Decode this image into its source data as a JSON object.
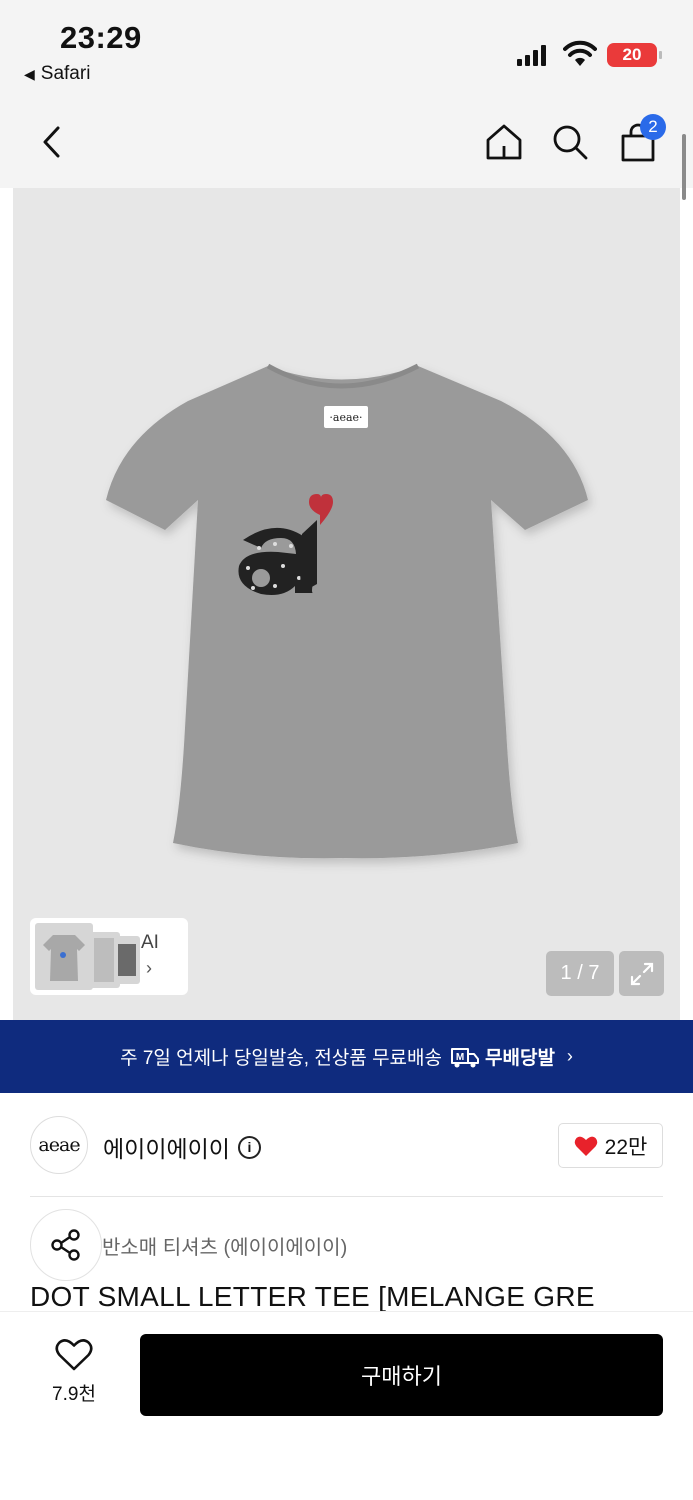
{
  "status_bar": {
    "time": "23:29",
    "back_app": "Safari",
    "battery": "20"
  },
  "nav": {
    "cart_count": "2"
  },
  "gallery": {
    "ai_label": "AI",
    "counter": "1 / 7",
    "logo_tag": "·aeae·"
  },
  "banner": {
    "text": "주 7일 언제나 당일발송, 전상품 무료배송",
    "brand": "무배당발"
  },
  "brand": {
    "logo": "aeae",
    "name": "에이이에이이",
    "likes": "22만"
  },
  "product": {
    "category": "반소매 티셔츠 (에이이에이이)",
    "title": "DOT SMALL LETTER TEE [MELANGE GRE"
  },
  "bottom": {
    "wish_count": "7.9천",
    "buy_label": "구매하기"
  },
  "colors": {
    "banner_bg": "#0f2b7e",
    "cart_badge": "#2a6ae9",
    "heart": "#e8222b",
    "battery": "#ea3a3a"
  }
}
